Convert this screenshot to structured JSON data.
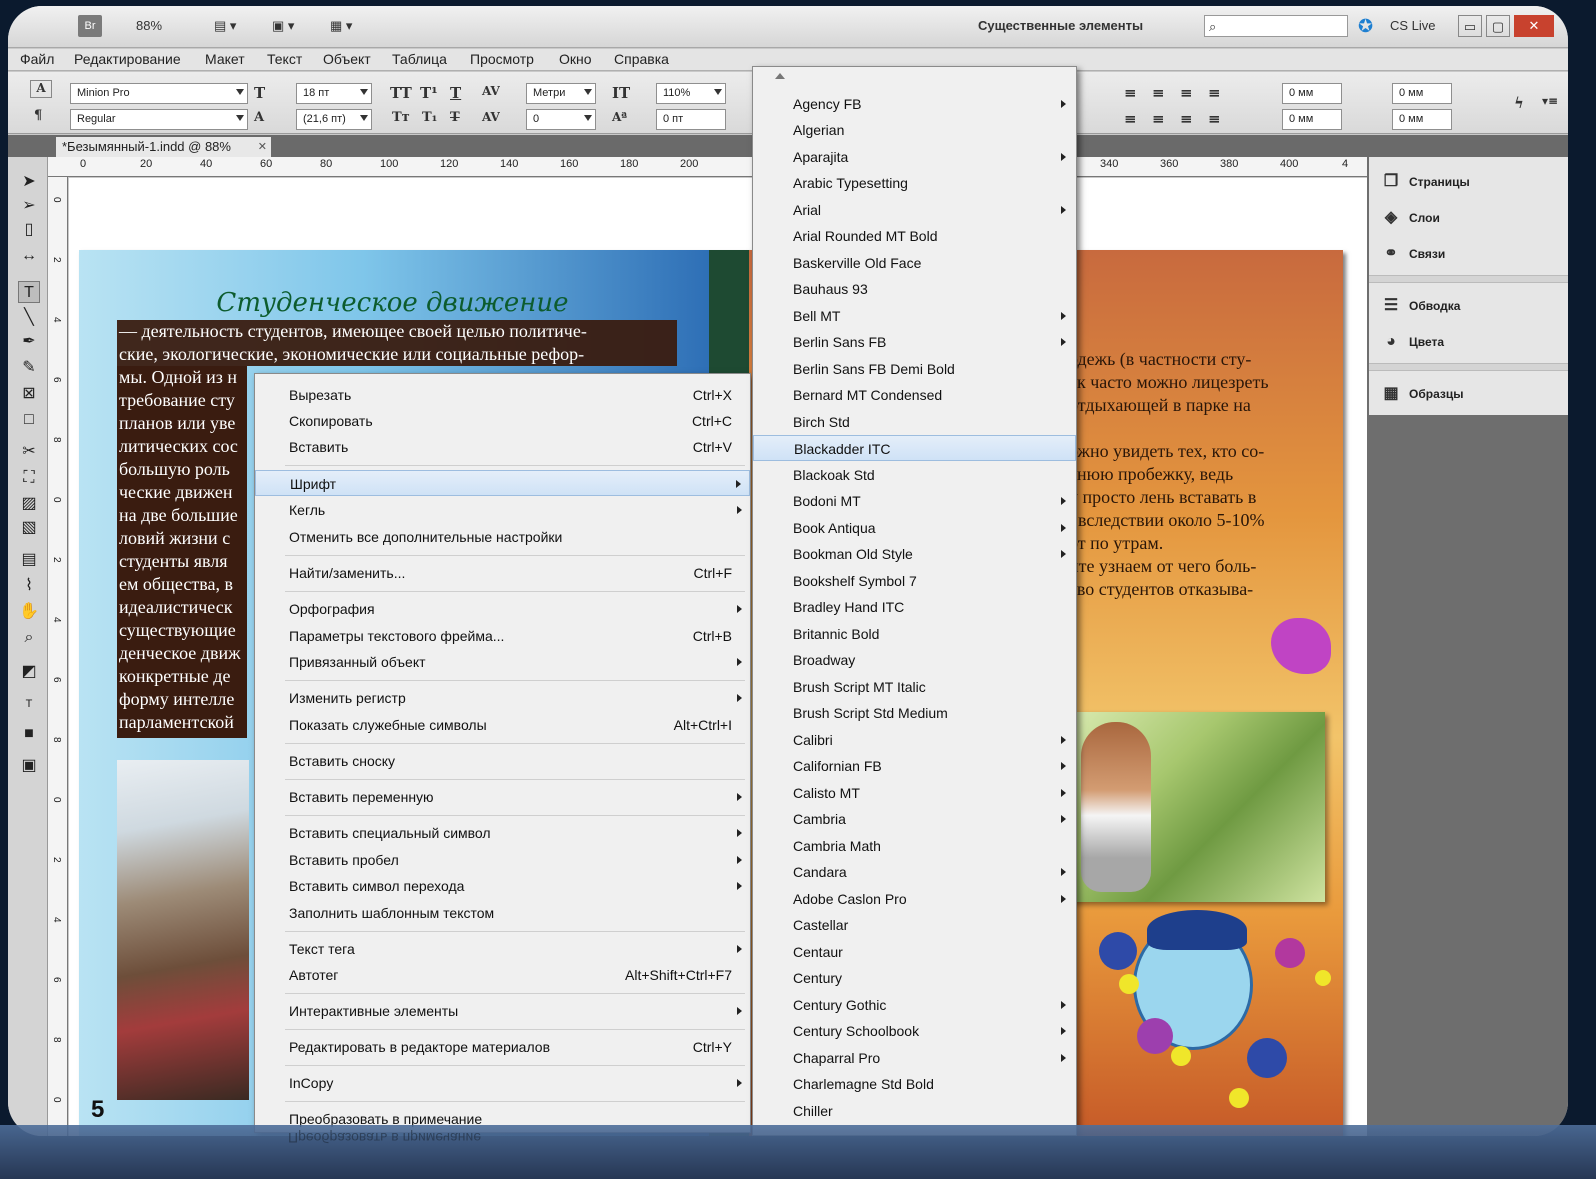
{
  "app_bar": {
    "bridge": "Br",
    "zoom": "88%",
    "workspace": "Существенные элементы",
    "cs_live": "CS Live"
  },
  "menu": [
    "Файл",
    "Редактирование",
    "Макет",
    "Текст",
    "Объект",
    "Таблица",
    "Просмотр",
    "Окно",
    "Справка"
  ],
  "control": {
    "font_family": "Minion Pro",
    "font_style": "Regular",
    "font_size": "18 пт",
    "leading": "(21,6 пт)",
    "kerning": "Метри",
    "tracking": "0",
    "vscale": "110%",
    "baseline": "0 пт",
    "indent_left": "0 мм",
    "indent_first": "0 мм",
    "indent_right": "0 мм",
    "indent_last": "0 мм"
  },
  "document_tab": "*Безымянный-1.indd @ 88%",
  "ruler": [
    "0",
    "20",
    "40",
    "60",
    "80",
    "100",
    "120",
    "140",
    "160",
    "180",
    "200",
    "340",
    "360",
    "380",
    "400",
    "4"
  ],
  "vruler": [
    "0",
    "2",
    "4",
    "6",
    "8",
    "0",
    "2",
    "4",
    "6",
    "8",
    "0",
    "2",
    "4",
    "6",
    "8",
    "0",
    "2",
    "4",
    "6",
    "8",
    "0",
    "2",
    "4",
    "6",
    "8",
    "0",
    "2"
  ],
  "page": {
    "heading": "Студенческое движение",
    "intro_lines": [
      "— деятельность студентов, имеющее своей целью политиче-",
      "ские, экологические, экономические или социальные рефор-"
    ],
    "body_lines": [
      "мы. Одной из н",
      "требование сту",
      "планов или уве",
      "литических сос",
      "большую роль",
      "ческие движен",
      "на две большие",
      "ловий жизни с",
      "студенты явля",
      "ем общества, в",
      "идеалистическ",
      "существующие",
      "денческое движ",
      "конкретные де",
      "форму интелле",
      "парламентской"
    ],
    "page_number": "5",
    "right_lines": [
      "одежь (в частности сту-",
      "ак часто можно лицезреть",
      "отдыхающей в парке на",
      "",
      "ожно увидеть тех, кто со-",
      "енюю пробежку, ведь",
      "у просто лень вставать в",
      ". вследствии около 5-10%",
      "от по утрам.",
      "йте узнаем от чего боль-",
      "тво студентов отказыва-"
    ]
  },
  "context_menu": [
    {
      "label": "Вырезать",
      "shortcut": "Ctrl+X"
    },
    {
      "label": "Скопировать",
      "shortcut": "Ctrl+C"
    },
    {
      "label": "Вставить",
      "shortcut": "Ctrl+V"
    },
    {
      "label": "Шрифт",
      "shortcut": "",
      "submenu": true,
      "highlighted": true
    },
    {
      "label": "Кегль",
      "shortcut": "",
      "submenu": true
    },
    {
      "label": "Отменить все дополнительные настройки",
      "shortcut": ""
    },
    {
      "label": "Найти/заменить...",
      "shortcut": "Ctrl+F"
    },
    {
      "label": "Орфография",
      "shortcut": "",
      "submenu": true
    },
    {
      "label": "Параметры текстового фрейма...",
      "shortcut": "Ctrl+B"
    },
    {
      "label": "Привязанный объект",
      "shortcut": "",
      "submenu": true
    },
    {
      "label": "Изменить регистр",
      "shortcut": "",
      "submenu": true
    },
    {
      "label": "Показать служебные символы",
      "shortcut": "Alt+Ctrl+I"
    },
    {
      "label": "Вставить сноску",
      "shortcut": ""
    },
    {
      "label": "Вставить переменную",
      "shortcut": "",
      "submenu": true
    },
    {
      "label": "Вставить специальный символ",
      "shortcut": "",
      "submenu": true
    },
    {
      "label": "Вставить пробел",
      "shortcut": "",
      "submenu": true
    },
    {
      "label": "Вставить символ перехода",
      "shortcut": "",
      "submenu": true
    },
    {
      "label": "Заполнить шаблонным текстом",
      "shortcut": ""
    },
    {
      "label": "Текст тега",
      "shortcut": "",
      "submenu": true
    },
    {
      "label": "Автотег",
      "shortcut": "Alt+Shift+Ctrl+F7"
    },
    {
      "label": "Интерактивные элементы",
      "shortcut": "",
      "submenu": true
    },
    {
      "label": "Редактировать в редакторе материалов",
      "shortcut": "Ctrl+Y"
    },
    {
      "label": "InCopy",
      "shortcut": "",
      "submenu": true
    },
    {
      "label": "Преобразовать в примечание",
      "shortcut": ""
    }
  ],
  "font_menu": [
    {
      "label": "Agency FB",
      "submenu": true
    },
    {
      "label": "Algerian"
    },
    {
      "label": "Aparajita",
      "submenu": true
    },
    {
      "label": "Arabic Typesetting"
    },
    {
      "label": "Arial",
      "submenu": true
    },
    {
      "label": "Arial Rounded MT Bold"
    },
    {
      "label": "Baskerville Old Face"
    },
    {
      "label": "Bauhaus 93"
    },
    {
      "label": "Bell MT",
      "submenu": true
    },
    {
      "label": "Berlin Sans FB",
      "submenu": true
    },
    {
      "label": "Berlin Sans FB Demi Bold"
    },
    {
      "label": "Bernard MT Condensed"
    },
    {
      "label": "Birch Std"
    },
    {
      "label": "Blackadder ITC",
      "highlighted": true
    },
    {
      "label": "Blackoak Std"
    },
    {
      "label": "Bodoni MT",
      "submenu": true
    },
    {
      "label": "Book Antiqua",
      "submenu": true
    },
    {
      "label": "Bookman Old Style",
      "submenu": true
    },
    {
      "label": "Bookshelf Symbol 7"
    },
    {
      "label": "Bradley Hand ITC"
    },
    {
      "label": "Britannic Bold"
    },
    {
      "label": "Broadway"
    },
    {
      "label": "Brush Script MT Italic"
    },
    {
      "label": "Brush Script Std Medium"
    },
    {
      "label": "Calibri",
      "submenu": true
    },
    {
      "label": "Californian FB",
      "submenu": true
    },
    {
      "label": "Calisto MT",
      "submenu": true
    },
    {
      "label": "Cambria",
      "submenu": true
    },
    {
      "label": "Cambria Math"
    },
    {
      "label": "Candara",
      "submenu": true
    },
    {
      "label": "Adobe Caslon Pro",
      "submenu": true
    },
    {
      "label": "Castellar"
    },
    {
      "label": "Centaur"
    },
    {
      "label": "Century"
    },
    {
      "label": "Century Gothic",
      "submenu": true
    },
    {
      "label": "Century Schoolbook",
      "submenu": true
    },
    {
      "label": "Chaparral Pro",
      "submenu": true
    },
    {
      "label": "Charlemagne Std Bold"
    },
    {
      "label": "Chiller"
    }
  ],
  "panels": [
    "Страницы",
    "Слои",
    "Связи",
    "Обводка",
    "Цвета",
    "Образцы"
  ]
}
